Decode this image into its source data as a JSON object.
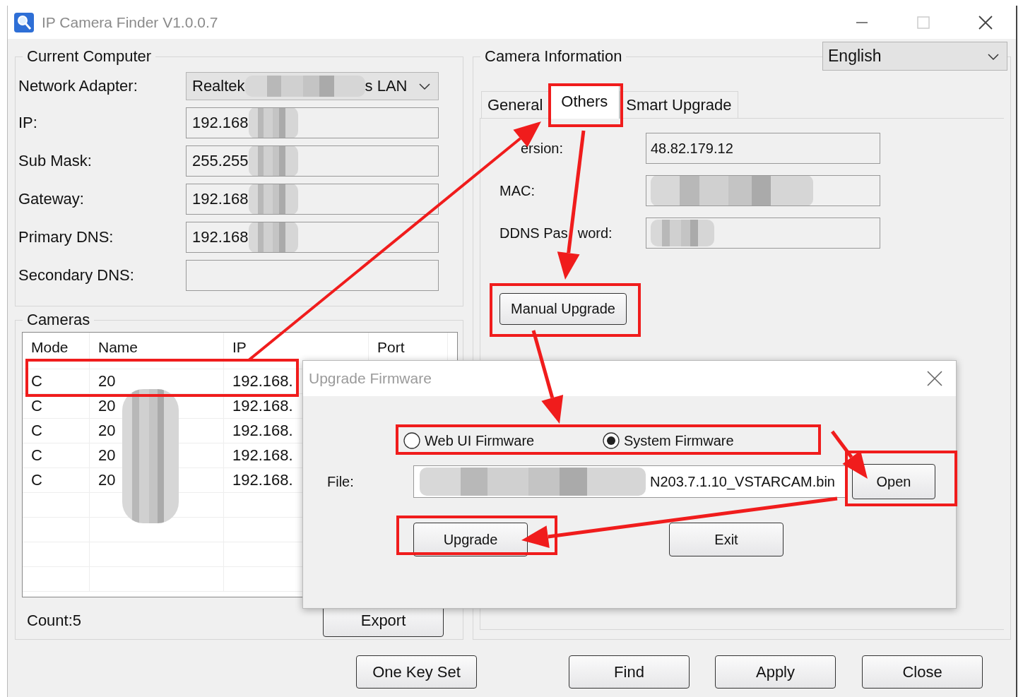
{
  "window": {
    "title": "IP Camera Finder V1.0.0.7"
  },
  "current_computer": {
    "title": "Current Computer",
    "fields": [
      {
        "label": "Network Adapter:",
        "kind": "select",
        "value": "Realtek",
        "value_tail": "s LAN",
        "blurred": true
      },
      {
        "label": "IP:",
        "kind": "text",
        "value": "192.168",
        "blurred": true
      },
      {
        "label": "Sub Mask:",
        "kind": "text",
        "value": "255.255",
        "blurred": true
      },
      {
        "label": "Gateway:",
        "kind": "text",
        "value": "192.168",
        "blurred": true
      },
      {
        "label": "Primary DNS:",
        "kind": "text",
        "value": "192.168",
        "blurred": true
      },
      {
        "label": "Secondary DNS:",
        "kind": "text",
        "blurred": false
      }
    ]
  },
  "cameras": {
    "title": "Cameras",
    "columns": [
      "Mode",
      "Name",
      "IP",
      "Port"
    ],
    "rows": [
      {
        "mode": "C",
        "name": "20",
        "ip": "192.168."
      },
      {
        "mode": "C",
        "name": "20",
        "ip": "192.168."
      },
      {
        "mode": "C",
        "name": "20",
        "ip": "192.168."
      },
      {
        "mode": "C",
        "name": "20",
        "ip": "192.168."
      },
      {
        "mode": "C",
        "name": "20",
        "ip": "192.168."
      }
    ],
    "count": "Count:5",
    "export_button": "Export"
  },
  "camera_info": {
    "title": "Camera Information",
    "language": "English",
    "tabs": [
      {
        "label": "General",
        "selected": false
      },
      {
        "label": "Others",
        "selected": true
      },
      {
        "label": "Smart Upgrade",
        "selected": false
      }
    ],
    "fields": [
      {
        "label": "ersion:",
        "value": "48.82.179.12",
        "blurred": false
      },
      {
        "label": "MAC:",
        "blurred": true
      },
      {
        "label": "DDNS Pas",
        "label_tail": "word:",
        "blurred": true
      }
    ],
    "manual_upgrade_button": "Manual Upgrade"
  },
  "buttons": [
    "One Key Set",
    "Find",
    "Apply",
    "Close"
  ],
  "dialog": {
    "title": "Upgrade Firmware",
    "options": [
      {
        "label": "Web UI Firmware",
        "selected": false
      },
      {
        "label": "System Firmware",
        "selected": true
      }
    ],
    "file_label": "File:",
    "file_value": "N203.7.1.10_VSTARCAM.bin",
    "open_button": "Open",
    "upgrade_button": "Upgrade",
    "exit_button": "Exit"
  }
}
